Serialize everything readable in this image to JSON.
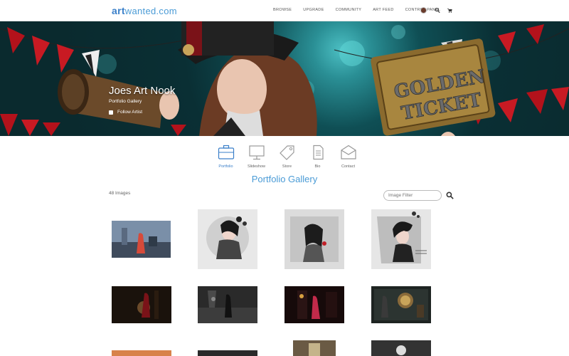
{
  "brand": {
    "logo_art": "art",
    "logo_rest": "wanted.com"
  },
  "nav": {
    "items": [
      "BROWSE",
      "UPGRADE",
      "COMMUNITY",
      "ART FEED",
      "CONTROL PANEL"
    ]
  },
  "banner": {
    "title": "Joes Art Nook",
    "subtitle": "Portfolio Gallery",
    "follow_label": "Follow Artist",
    "ticket_text_1": "GOLDEN",
    "ticket_text_2": "TICKET"
  },
  "tabs": [
    {
      "label": "Portfolio",
      "icon": "briefcase-icon",
      "active": true
    },
    {
      "label": "Slideshow",
      "icon": "monitor-icon",
      "active": false
    },
    {
      "label": "Store",
      "icon": "tag-icon",
      "active": false
    },
    {
      "label": "Bio",
      "icon": "document-icon",
      "active": false
    },
    {
      "label": "Contact",
      "icon": "envelope-icon",
      "active": false
    }
  ],
  "gallery": {
    "title": "Portfolio Gallery",
    "count_label": "48 Images",
    "filter_placeholder": "Image Filter"
  },
  "colors": {
    "accent": "#4a9bd6",
    "brand": "#3a7fc9"
  }
}
